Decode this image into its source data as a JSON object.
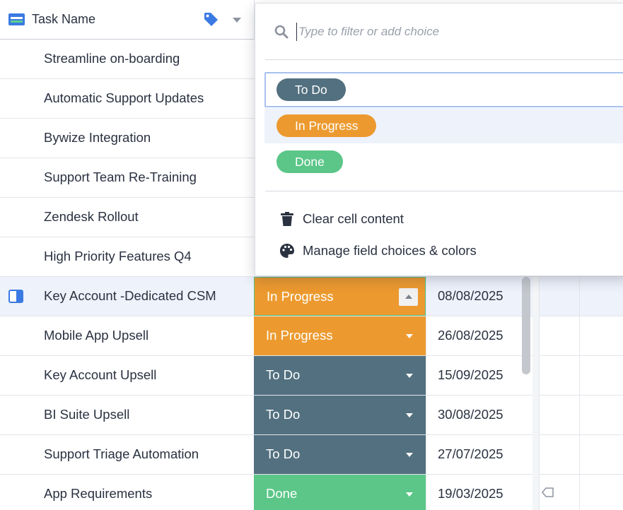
{
  "columns": {
    "task_name_header": "Task Name"
  },
  "colors": {
    "to_do": "#52707f",
    "in_progress": "#ec9a2f",
    "done": "#5bc688",
    "selection": "#3b7ae2"
  },
  "rows": [
    {
      "name": "Streamline on-boarding"
    },
    {
      "name": "Automatic Support Updates"
    },
    {
      "name": "Bywize Integration"
    },
    {
      "name": "Support Team Re-Training"
    },
    {
      "name": "Zendesk Rollout"
    },
    {
      "name": "High Priority Features Q4"
    },
    {
      "name": "Key Account -Dedicated CSM",
      "status": "In Progress",
      "date": "08/08/2025",
      "selected": true
    },
    {
      "name": "Mobile App Upsell",
      "status": "In Progress",
      "date": "26/08/2025"
    },
    {
      "name": "Key Account Upsell",
      "status": "To Do",
      "date": "15/09/2025"
    },
    {
      "name": "BI Suite Upsell",
      "status": "To Do",
      "date": "30/08/2025"
    },
    {
      "name": "Support Triage Automation",
      "status": "To Do",
      "date": "27/07/2025"
    },
    {
      "name": "App Requirements",
      "status": "Done",
      "date": "19/03/2025"
    }
  ],
  "dropdown": {
    "search_placeholder": "Type to filter or add choice",
    "search_value": "",
    "choices": [
      {
        "label": "To Do",
        "color": "#52707f",
        "state": "focused"
      },
      {
        "label": "In Progress",
        "color": "#ec9a2f",
        "state": "hover"
      },
      {
        "label": "Done",
        "color": "#5bc688",
        "state": ""
      }
    ],
    "actions": [
      {
        "label": "Clear cell content",
        "icon": "trash-icon"
      },
      {
        "label": "Manage field choices & colors",
        "icon": "palette-icon"
      }
    ]
  }
}
